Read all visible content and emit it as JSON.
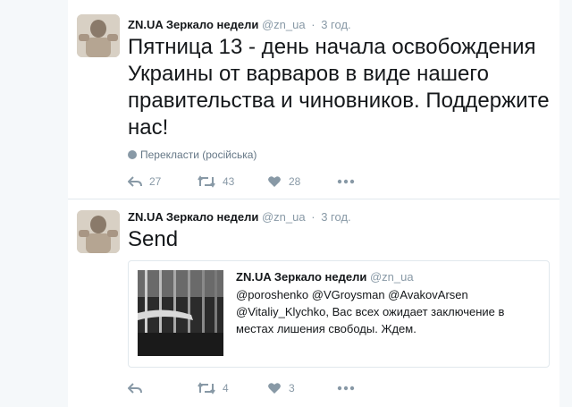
{
  "tweets": [
    {
      "author": {
        "name": "ZN.UA Зеркало недели",
        "handle": "@zn_ua"
      },
      "time": "3 год.",
      "text": "Пятница 13 - день начала освобождения Украины от варваров в виде нашего правительства и чиновников. Поддержите нас!",
      "translate": "Перекласти (російська)",
      "actions": {
        "reply": "27",
        "retweet": "43",
        "like": "28"
      }
    },
    {
      "author": {
        "name": "ZN.UA Зеркало недели",
        "handle": "@zn_ua"
      },
      "time": "3 год.",
      "text": "Send",
      "quote": {
        "author": {
          "name": "ZN.UA Зеркало недели",
          "handle": "@zn_ua"
        },
        "text": "@poroshenko @VGroysman @AvakovArsen @Vitaliy_Klychko, Вас всех ожидает заключение в местах лишения свободы. Ждем."
      },
      "actions": {
        "reply": "",
        "retweet": "4",
        "like": "3"
      }
    }
  ],
  "colors": {
    "text": "#14171a",
    "muted": "#8899a6",
    "border": "#e1e8ed",
    "background": "#ffffff"
  },
  "icons": [
    "reply-icon",
    "retweet-icon",
    "heart-icon",
    "more-icon",
    "globe-icon"
  ]
}
